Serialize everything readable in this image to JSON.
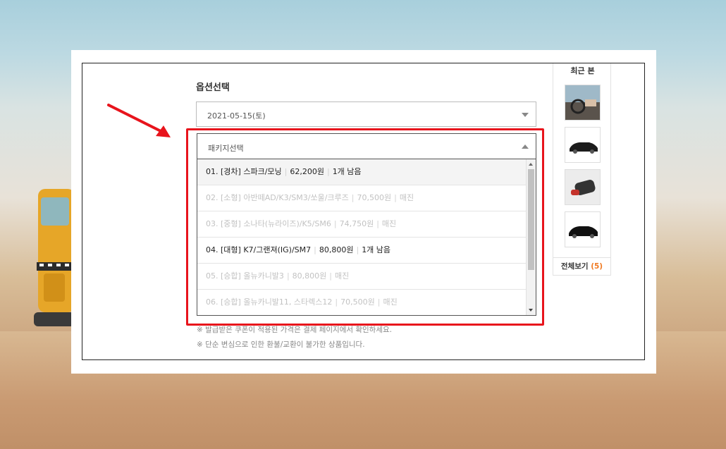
{
  "option_section": {
    "title": "옵션선택",
    "date_value": "2021-05-15(토)",
    "package_placeholder": "패키지선택",
    "options": [
      {
        "no": "01.",
        "category": "[경차]",
        "name": "스파크/모닝",
        "price": "62,200원",
        "status": "1개 남음",
        "available": true
      },
      {
        "no": "02.",
        "category": "[소형]",
        "name": "아반떼AD/K3/SM3/쏘울/크루즈",
        "price": "70,500원",
        "status": "매진",
        "available": false
      },
      {
        "no": "03.",
        "category": "[중형]",
        "name": "소나타(뉴라이즈)/K5/SM6",
        "price": "74,750원",
        "status": "매진",
        "available": false
      },
      {
        "no": "04.",
        "category": "[대형]",
        "name": "K7/그랜져(IG)/SM7",
        "price": "80,800원",
        "status": "1개 남음",
        "available": true
      },
      {
        "no": "05.",
        "category": "[승합]",
        "name": "올뉴카니발3",
        "price": "80,800원",
        "status": "매진",
        "available": false
      },
      {
        "no": "06.",
        "category": "[승합]",
        "name": "올뉴카니발11, 스타렉스12",
        "price": "70,500원",
        "status": "매진",
        "available": false
      }
    ],
    "notes": [
      "※ 발급받은 쿠폰이 적용된 가격은 결제 페이지에서 확인하세요.",
      "※ 단순 변심으로 인한 환불/교환이 불가한 상품입니다."
    ]
  },
  "recent_panel": {
    "title": "최근 본",
    "view_all_label": "전체보기",
    "view_all_count": "(5)"
  },
  "colors": {
    "highlight": "#e8141c",
    "count_accent": "#f07a22"
  },
  "icons": [
    "dropdown-caret-down-icon",
    "dropdown-caret-up-icon",
    "red-arrow-annotation"
  ]
}
